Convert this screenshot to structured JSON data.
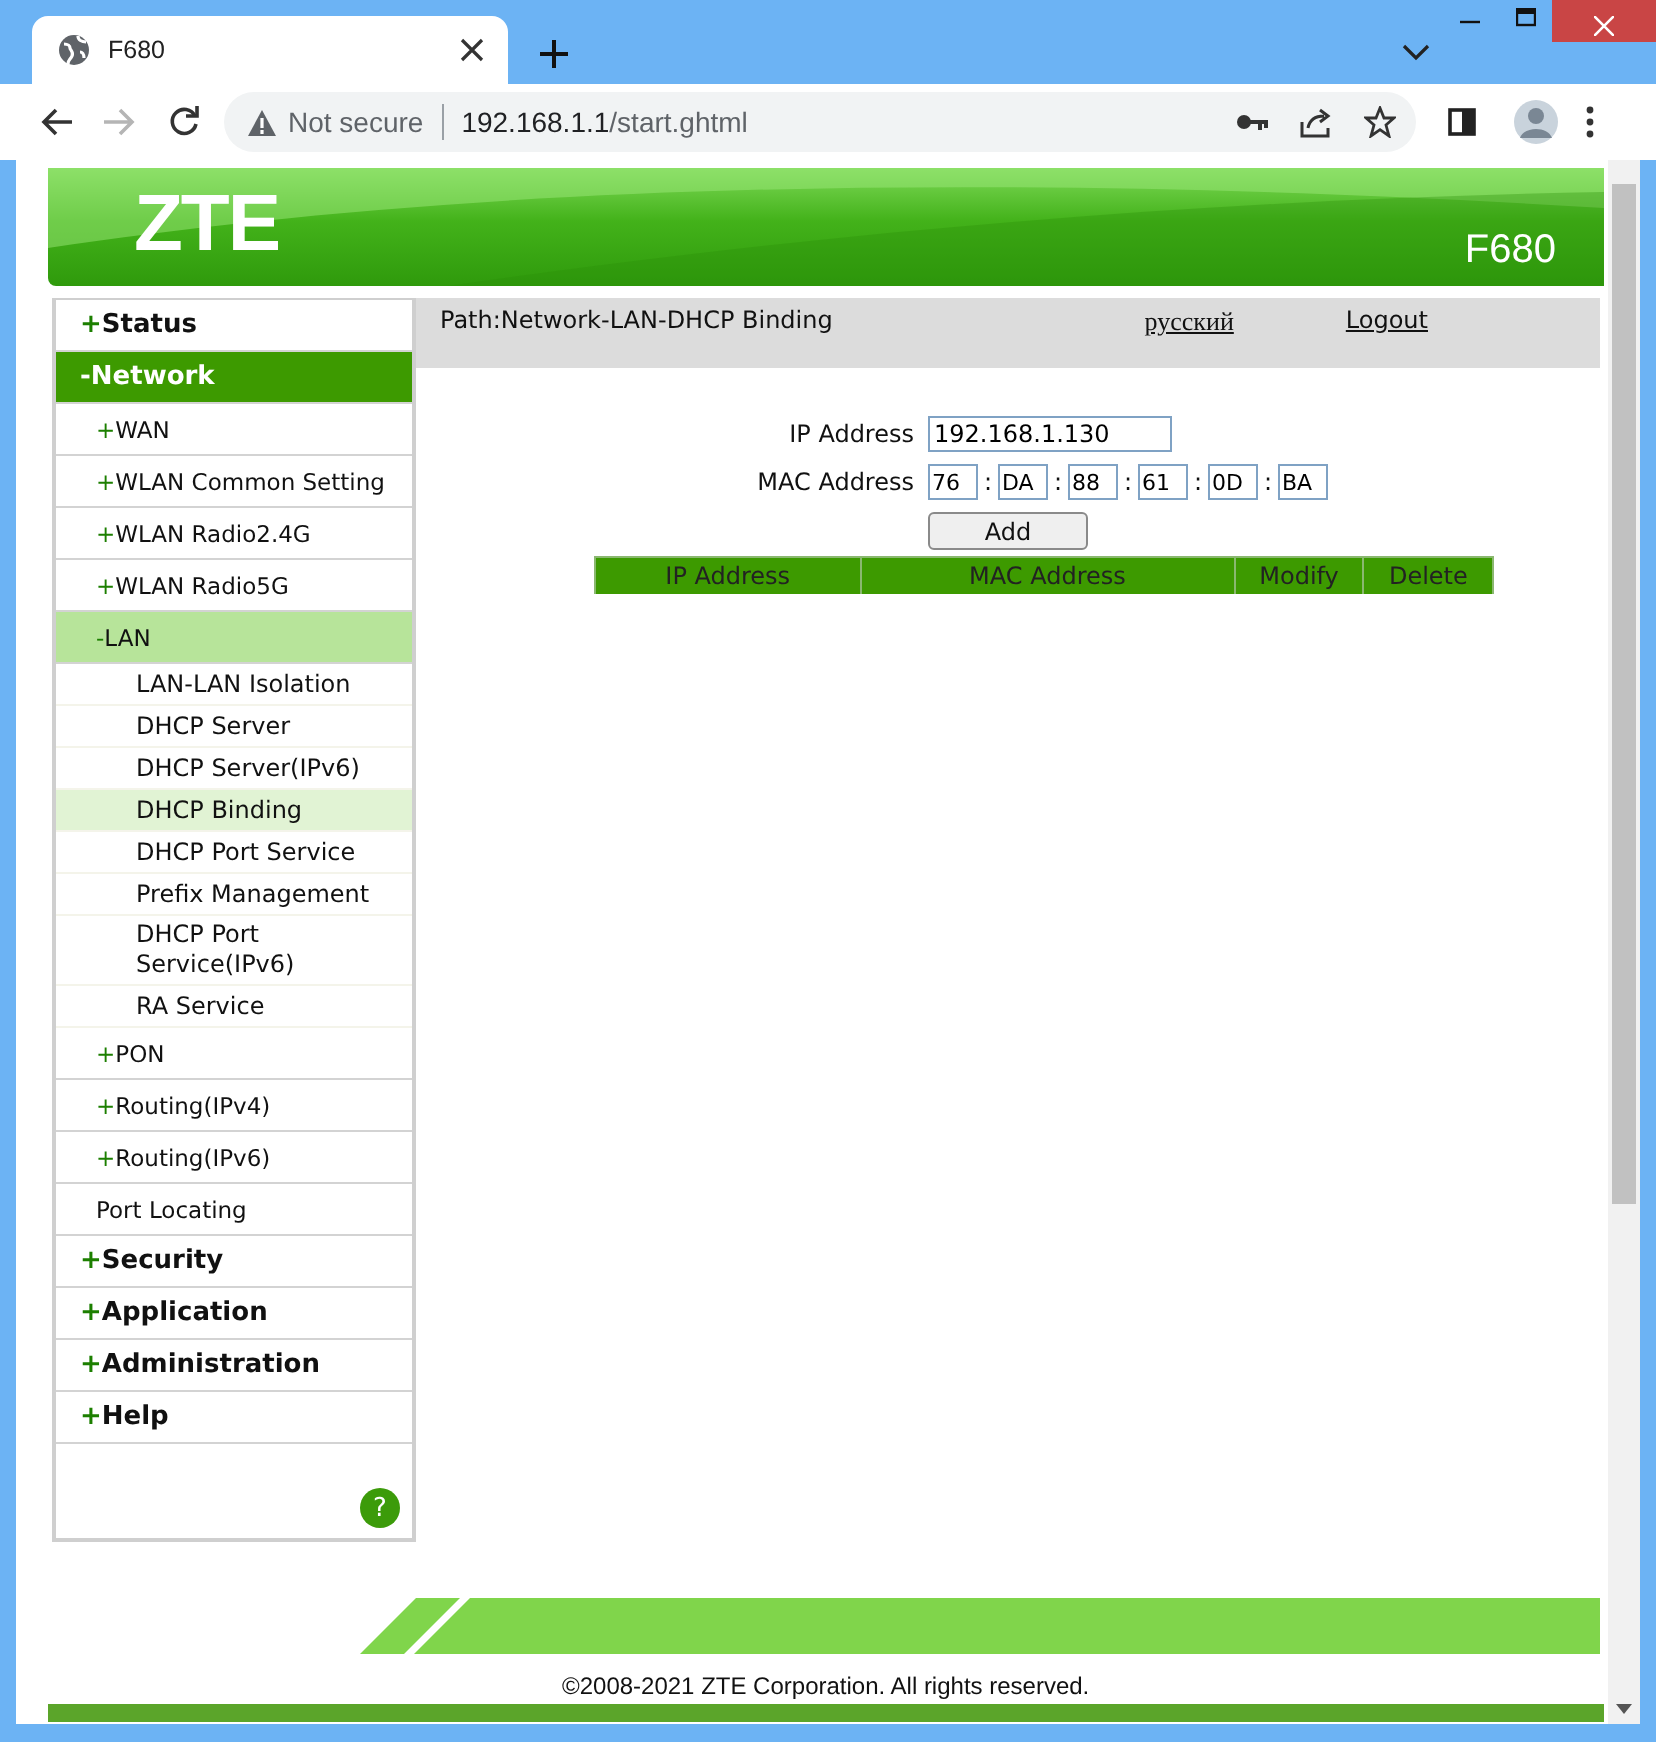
{
  "browser": {
    "tab_title": "F680",
    "security_label": "Not secure",
    "url_host": "192.168.1.1",
    "url_path": "/start.ghtml"
  },
  "header": {
    "logo": "ZTE",
    "model": "F680"
  },
  "menu": [
    {
      "marker": "+",
      "label": "Status",
      "selected": false
    },
    {
      "marker": "-",
      "label": "Network",
      "selected": true,
      "children": [
        {
          "marker": "+",
          "label": "WAN",
          "selected": false
        },
        {
          "marker": "+",
          "label": "WLAN Common Setting",
          "selected": false
        },
        {
          "marker": "+",
          "label": "WLAN Radio2.4G",
          "selected": false
        },
        {
          "marker": "+",
          "label": "WLAN Radio5G",
          "selected": false
        },
        {
          "marker": "-",
          "label": "LAN",
          "selected": true,
          "children": [
            {
              "label": "LAN-LAN Isolation",
              "selected": false
            },
            {
              "label": "DHCP Server",
              "selected": false
            },
            {
              "label": "DHCP Server(IPv6)",
              "selected": false
            },
            {
              "label": "DHCP Binding",
              "selected": true
            },
            {
              "label": "DHCP Port Service",
              "selected": false
            },
            {
              "label": "Prefix Management",
              "selected": false
            },
            {
              "label": "DHCP Port Service(IPv6)",
              "selected": false
            },
            {
              "label": "RA Service",
              "selected": false
            }
          ]
        },
        {
          "marker": "+",
          "label": "PON",
          "selected": false
        },
        {
          "marker": "+",
          "label": "Routing(IPv4)",
          "selected": false
        },
        {
          "marker": "+",
          "label": "Routing(IPv6)",
          "selected": false
        },
        {
          "label": "Port Locating",
          "selected": false
        }
      ]
    },
    {
      "marker": "+",
      "label": "Security",
      "selected": false
    },
    {
      "marker": "+",
      "label": "Application",
      "selected": false
    },
    {
      "marker": "+",
      "label": "Administration",
      "selected": false
    },
    {
      "marker": "+",
      "label": "Help",
      "selected": false
    }
  ],
  "help_button": "?",
  "content": {
    "path": "Path:Network-LAN-DHCP Binding",
    "language_link": "русский",
    "logout_link": "Logout",
    "form": {
      "ip_label": "IP Address",
      "ip_value": "192.168.1.130",
      "mac_label": "MAC Address",
      "mac_octets": [
        "76",
        "DA",
        "88",
        "61",
        "0D",
        "BA"
      ],
      "mac_separators": [
        ":",
        ":",
        ":",
        ":",
        ":"
      ],
      "add_button": "Add"
    },
    "table": {
      "columns": [
        "IP Address",
        "MAC Address",
        "Modify",
        "Delete"
      ]
    }
  },
  "footer": {
    "copyright": "©2008-2021 ZTE Corporation. All rights reserved."
  }
}
